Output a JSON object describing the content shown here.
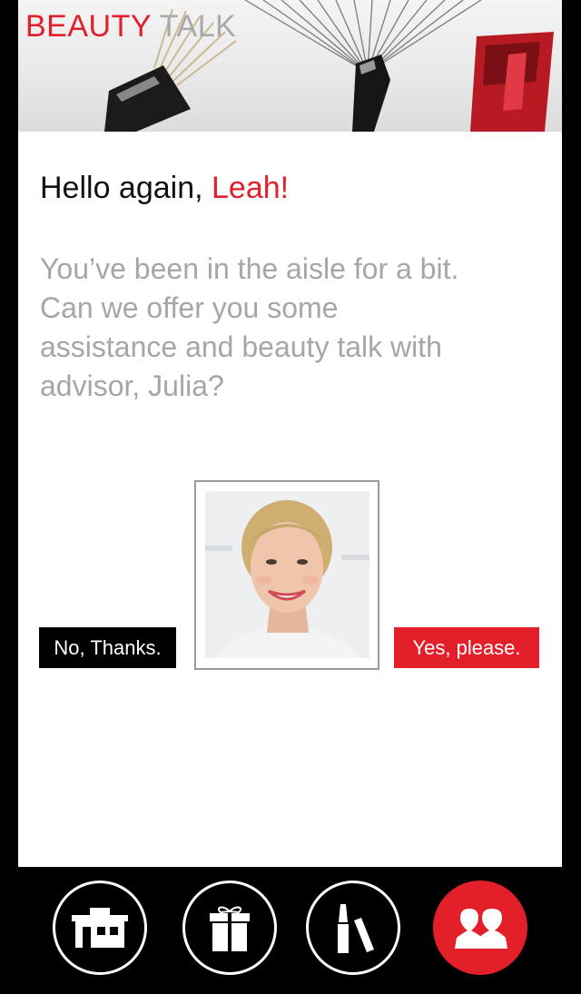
{
  "header": {
    "brand_part1": "BEAUTY",
    "brand_part2": "TALK"
  },
  "greeting": {
    "prefix": "Hello again, ",
    "name": "Leah!"
  },
  "message": "You’ve been in the aisle for a bit. Can we offer you some assistance and beauty talk with advisor, Julia?",
  "actions": {
    "decline_label": "No, Thanks.",
    "accept_label": "Yes, please."
  },
  "nav": {
    "items": [
      {
        "icon": "home-icon",
        "active": false
      },
      {
        "icon": "gift-icon",
        "active": false
      },
      {
        "icon": "lipstick-icon",
        "active": false
      },
      {
        "icon": "advisor-people-icon",
        "active": true
      }
    ]
  },
  "colors": {
    "accent": "#e3202a",
    "text_dark": "#111111",
    "text_muted": "#a6a6a6",
    "nav_bg": "#000000"
  }
}
